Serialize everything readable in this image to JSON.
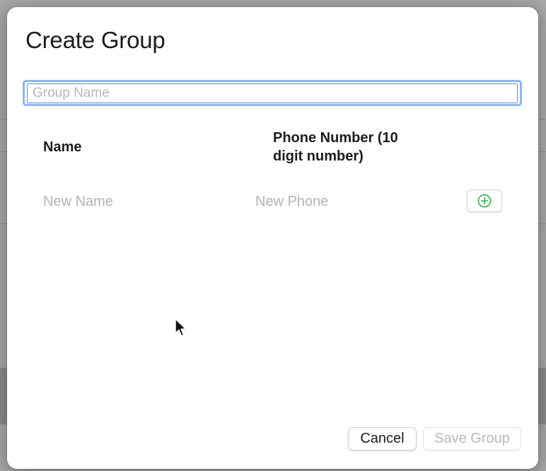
{
  "dialog": {
    "title": "Create Group",
    "group_name": {
      "value": "",
      "placeholder": "Group Name"
    },
    "columns": {
      "name": "Name",
      "phone": "Phone Number (10 digit number)"
    },
    "new_row": {
      "name_placeholder": "New Name",
      "phone_placeholder": "New Phone",
      "add_icon": "plus-circle-icon",
      "add_icon_color": "#2fb24c"
    },
    "footer": {
      "cancel_label": "Cancel",
      "save_label": "Save Group",
      "save_enabled": false
    }
  },
  "colors": {
    "focus_ring": "#8fb6ee",
    "placeholder": "#b7b7bb",
    "disabled_text": "#b9b9bd"
  }
}
